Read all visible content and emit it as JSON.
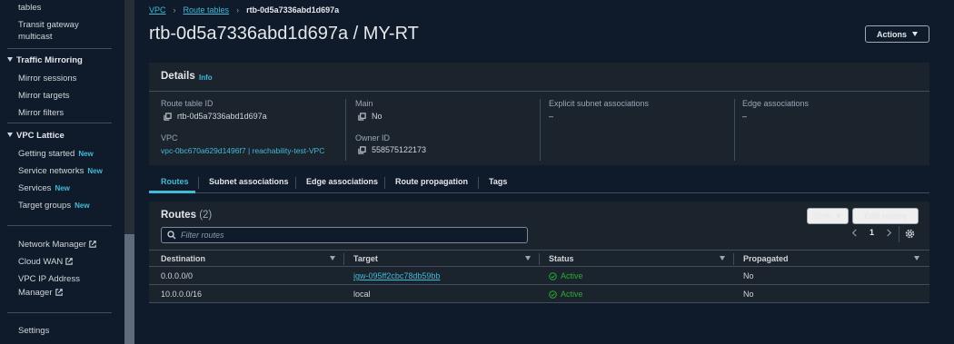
{
  "sidebar": {
    "top_items": [
      "tables",
      "Transit gateway",
      "multicast"
    ],
    "traffic_mirroring": {
      "title": "Traffic Mirroring",
      "items": [
        "Mirror sessions",
        "Mirror targets",
        "Mirror filters"
      ]
    },
    "vpc_lattice": {
      "title": "VPC Lattice",
      "items": [
        {
          "label": "Getting started",
          "badge": "New"
        },
        {
          "label": "Service networks",
          "badge": "New"
        },
        {
          "label": "Services",
          "badge": "New"
        },
        {
          "label": "Target groups",
          "badge": "New"
        }
      ]
    },
    "external": [
      "Network Manager",
      "Cloud WAN",
      "VPC IP Address",
      "Manager"
    ],
    "settings": "Settings"
  },
  "breadcrumb": {
    "items": [
      "VPC",
      "Route tables"
    ],
    "current": "rtb-0d5a7336abd1d697a"
  },
  "page_title": "rtb-0d5a7336abd1d697a / MY-RT",
  "actions_label": "Actions",
  "details": {
    "title": "Details",
    "info": "Info",
    "route_table_id_label": "Route table ID",
    "route_table_id": "rtb-0d5a7336abd1d697a",
    "vpc_label": "VPC",
    "vpc_value": "vpc-0bc670a629d1496f7 | reachability-test-VPC",
    "main_label": "Main",
    "main_value": "No",
    "owner_label": "Owner ID",
    "owner_value": "558575122173",
    "explicit_label": "Explicit subnet associations",
    "explicit_value": "–",
    "edge_label": "Edge associations",
    "edge_value": "–"
  },
  "tabs": [
    "Routes",
    "Subnet associations",
    "Edge associations",
    "Route propagation",
    "Tags"
  ],
  "routes": {
    "title": "Routes",
    "count": "(2)",
    "both_label": "Both",
    "edit_label": "Edit routes",
    "filter_placeholder": "Filter routes",
    "page": "1",
    "columns": [
      "Destination",
      "Target",
      "Status",
      "Propagated"
    ],
    "rows": [
      {
        "destination": "0.0.0.0/0",
        "target": "igw-095ff2cbc78db59bb",
        "status": "Active",
        "propagated": "No"
      },
      {
        "destination": "10.0.0.0/16",
        "target": "local",
        "status": "Active",
        "propagated": "No"
      }
    ]
  },
  "colors": {
    "accent": "#44b9d6",
    "status_active": "#29ad32",
    "panel": "#1b232d",
    "background": "#0f1b2a"
  }
}
